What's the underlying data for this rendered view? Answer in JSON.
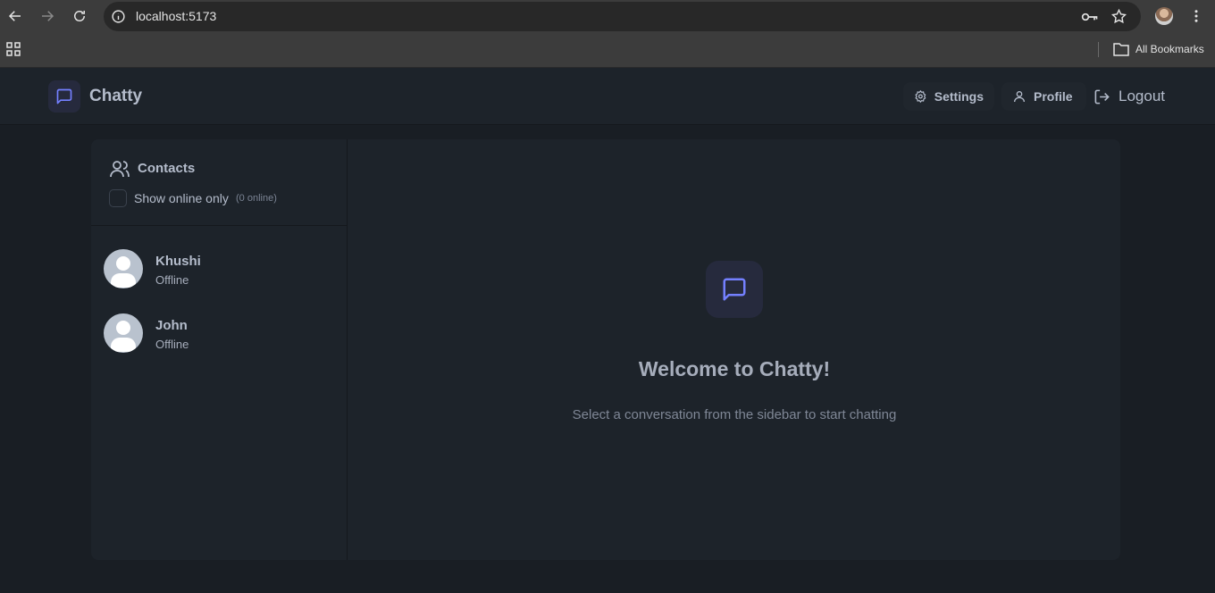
{
  "browser": {
    "url": "localhost:5173",
    "bookmarks_label": "All Bookmarks"
  },
  "header": {
    "brand": "Chatty",
    "settings_label": "Settings",
    "profile_label": "Profile",
    "logout_label": "Logout"
  },
  "sidebar": {
    "title": "Contacts",
    "filter_label": "Show online only",
    "online_count": "(0 online)",
    "contacts": [
      {
        "name": "Khushi",
        "status": "Offline"
      },
      {
        "name": "John",
        "status": "Offline"
      }
    ]
  },
  "main": {
    "welcome_title": "Welcome to Chatty!",
    "welcome_subtitle": "Select a conversation from the sidebar to start chatting"
  },
  "colors": {
    "accent": "#7480ff",
    "background": "#191e24",
    "panel": "#1d232a"
  }
}
